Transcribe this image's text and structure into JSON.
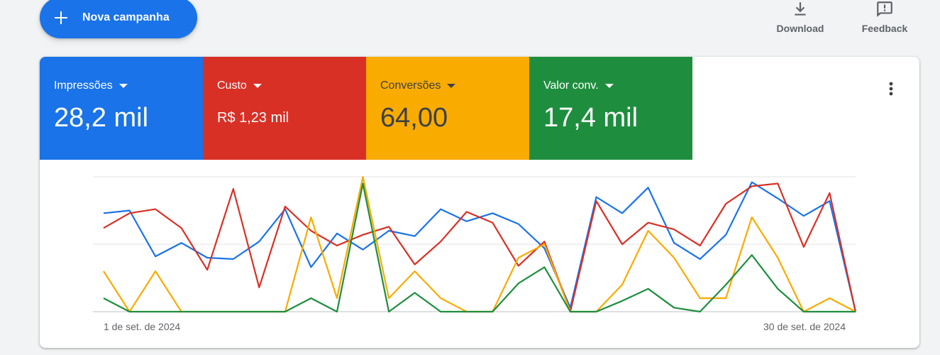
{
  "toolbar": {
    "new_campaign_label": "Nova campanha",
    "download_label": "Download",
    "feedback_label": "Feedback"
  },
  "metrics": [
    {
      "label": "Impressões",
      "value": "28,2 mil",
      "color": "#1a73e8"
    },
    {
      "label": "Custo",
      "value": "R$ 1,23 mil",
      "color": "#d93025"
    },
    {
      "label": "Conversões",
      "value": "64,00",
      "color": "#f9ab00"
    },
    {
      "label": "Valor conv.",
      "value": "17,4 mil",
      "color": "#1e8e3e"
    }
  ],
  "chart_data": {
    "type": "line",
    "x_start_label": "1 de set. de 2024",
    "x_end_label": "30 de set. de 2024",
    "grid": true,
    "ylim": [
      0,
      1
    ],
    "series": [
      {
        "name": "Impressões",
        "color": "#1a73e8",
        "values": [
          0.73,
          0.75,
          0.41,
          0.51,
          0.4,
          0.39,
          0.52,
          0.76,
          0.33,
          0.58,
          0.46,
          0.6,
          0.56,
          0.76,
          0.67,
          0.73,
          0.65,
          0.47,
          0.03,
          0.85,
          0.73,
          0.92,
          0.51,
          0.39,
          0.57,
          0.96,
          0.84,
          0.71,
          0.82,
          0.0
        ]
      },
      {
        "name": "Custo",
        "color": "#d93025",
        "values": [
          0.62,
          0.73,
          0.76,
          0.62,
          0.31,
          0.91,
          0.18,
          0.78,
          0.6,
          0.49,
          0.57,
          0.63,
          0.35,
          0.52,
          0.74,
          0.66,
          0.34,
          0.52,
          0.0,
          0.82,
          0.5,
          0.66,
          0.61,
          0.49,
          0.8,
          0.93,
          0.95,
          0.48,
          0.88,
          0.0
        ]
      },
      {
        "name": "Conversões",
        "color": "#f9ab00",
        "values": [
          0.3,
          0.0,
          0.3,
          0.0,
          0.0,
          0.0,
          0.0,
          0.0,
          0.7,
          0.1,
          1.0,
          0.1,
          0.3,
          0.1,
          0.0,
          0.0,
          0.4,
          0.5,
          0.0,
          0.0,
          0.2,
          0.6,
          0.4,
          0.1,
          0.1,
          0.7,
          0.4,
          0.0,
          0.1,
          0.0
        ]
      },
      {
        "name": "Valor conv.",
        "color": "#1e8e3e",
        "values": [
          0.1,
          0.0,
          0.0,
          0.0,
          0.0,
          0.0,
          0.0,
          0.0,
          0.1,
          0.0,
          0.95,
          0.0,
          0.14,
          0.0,
          0.0,
          0.0,
          0.21,
          0.33,
          0.0,
          0.0,
          0.08,
          0.17,
          0.03,
          0.0,
          0.2,
          0.42,
          0.17,
          0.0,
          0.0,
          0.0
        ]
      }
    ]
  }
}
